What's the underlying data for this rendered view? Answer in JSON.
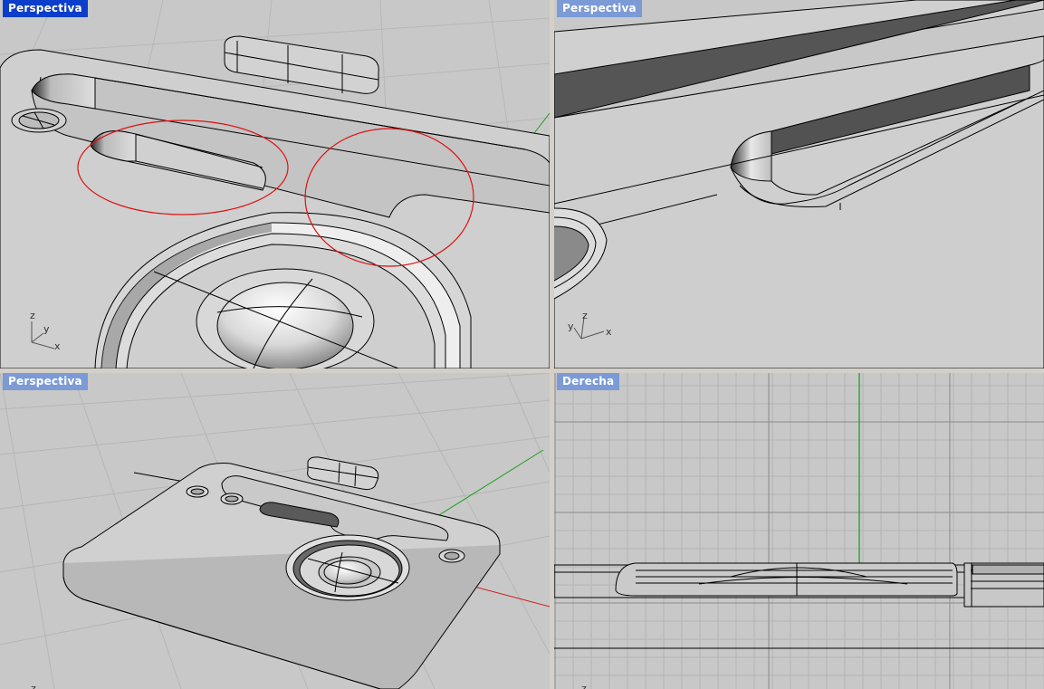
{
  "viewports": {
    "top_left": {
      "title": "Perspectiva",
      "active": true
    },
    "top_right": {
      "title": "Perspectiva",
      "active": false
    },
    "bottom_left": {
      "title": "Perspectiva",
      "active": false
    },
    "bottom_right": {
      "title": "Derecha",
      "active": false
    }
  },
  "axes": {
    "x": "x",
    "y": "y",
    "z": "z"
  },
  "colors": {
    "active_title": "#0a3ecb",
    "inactive_title": "#7b9ad6",
    "viewport_bg": "#c8c8c8",
    "grid_line": "#b4b4b4",
    "annotation_circle": "#e01010",
    "x_axis": "#d02020",
    "y_axis": "#20a020"
  },
  "icons": [
    "axis-triad-icon"
  ]
}
